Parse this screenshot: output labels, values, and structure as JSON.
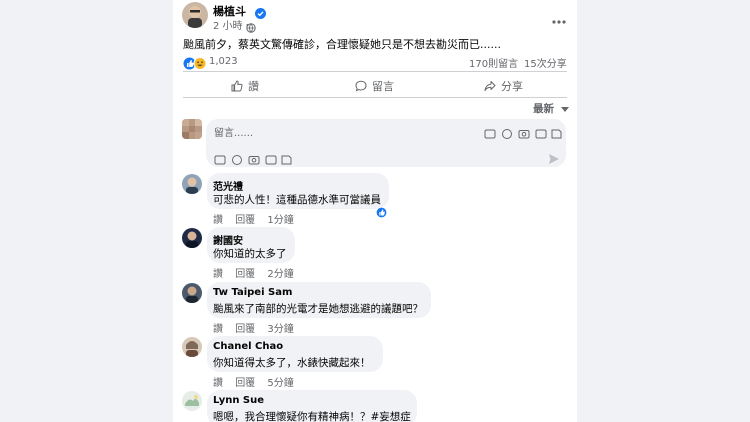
{
  "post": {
    "author": "楊植斗",
    "time": "2 小時・",
    "text": "颱風前夕，蔡英文驚傳確診，合理懷疑她只是不想去勘災而已......",
    "reaction_count": "1,023",
    "comment_count": "170則留言",
    "share_count": "15次分享",
    "more_icon": "more-horizontal-icon",
    "globe_icon": "globe-icon",
    "verified_color": "#1877f2"
  },
  "actions": {
    "like": "讚",
    "comment": "留言",
    "share": "分享"
  },
  "sort": {
    "label": "最新"
  },
  "composer": {
    "placeholder": "留言......"
  },
  "comments": [
    {
      "name": "范光禮",
      "text": "可悲的人性！這種品德水準可當議員",
      "like": "讚",
      "reply": "回覆",
      "time": "1分鐘"
    },
    {
      "name": "謝國安",
      "text": "你知道的太多了",
      "like": "讚",
      "reply": "回覆",
      "time": "2分鐘"
    },
    {
      "name": "Tw Taipei Sam",
      "text": "颱風來了南部的光電才是她想逃避的議題吧？",
      "like": "讚",
      "reply": "回覆",
      "time": "3分鐘"
    },
    {
      "name": "Chanel Chao",
      "text": "你知道得太多了，水錶快藏起來！",
      "like": "讚",
      "reply": "回覆",
      "time": "5分鐘"
    },
    {
      "name": "Lynn Sue",
      "text": "嗯嗯，我合理懷疑你有精神病！？#妄想症"
    }
  ]
}
